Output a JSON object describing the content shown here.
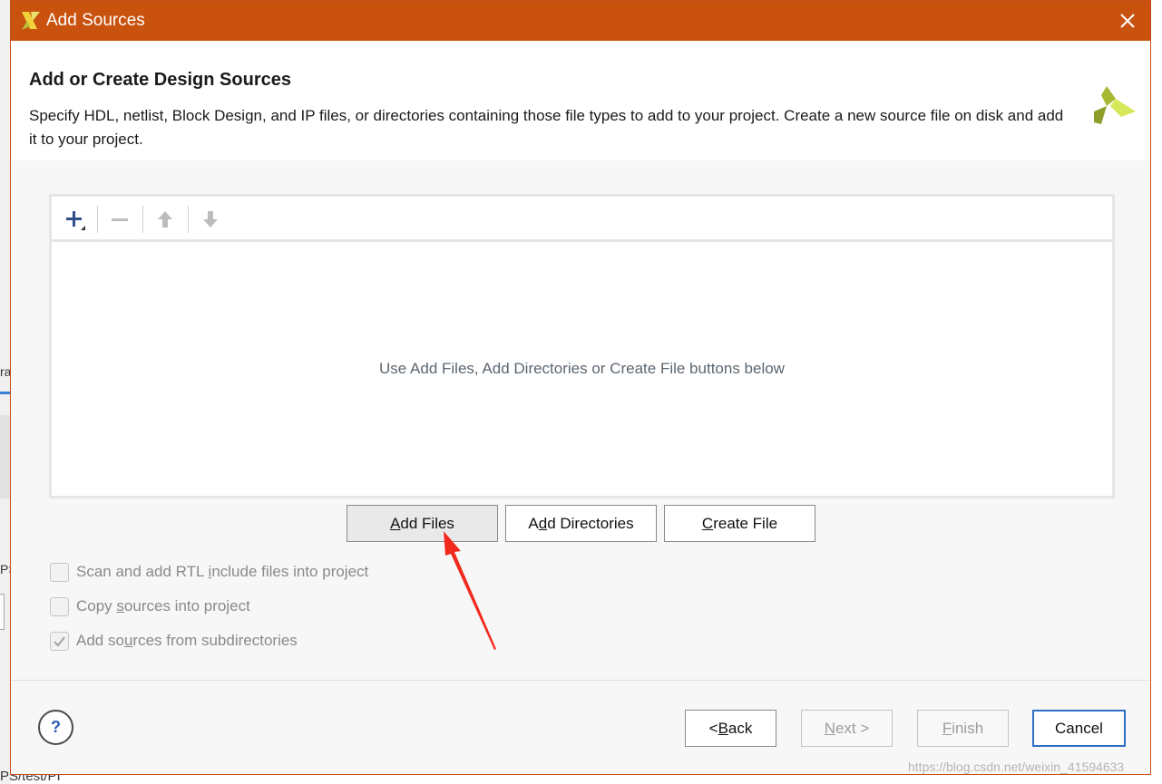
{
  "background": {
    "fragments": [
      "ra",
      "PS",
      "PS/test/PI"
    ]
  },
  "dialog": {
    "title": "Add Sources",
    "heading": "Add or Create Design Sources",
    "description": "Specify HDL, netlist, Block Design, and IP files, or directories containing those file types to add to your project. Create a new source file on disk and add it to your project.",
    "empty_message": "Use Add Files, Add Directories or Create File buttons below",
    "toolbar": {
      "add_icon": "plus-icon",
      "remove_icon": "minus-icon",
      "up_icon": "arrow-up-icon",
      "down_icon": "arrow-down-icon"
    },
    "buttons": {
      "add_files": {
        "mnemonic": "A",
        "rest": "dd Files"
      },
      "add_directories": {
        "pre": "A",
        "mnemonic": "d",
        "rest": "d Directories"
      },
      "create_file": {
        "mnemonic": "C",
        "rest": "reate File"
      }
    },
    "options": [
      {
        "pre": "Scan and add RTL ",
        "mnemonic": "i",
        "post": "nclude files into project",
        "checked": false
      },
      {
        "pre": "Copy ",
        "mnemonic": "s",
        "post": "ources into project",
        "checked": false
      },
      {
        "pre": "Add so",
        "mnemonic": "u",
        "post": "rces from subdirectories",
        "checked": true
      }
    ],
    "footer": {
      "help": "?",
      "back": {
        "pre": "< ",
        "mnemonic": "B",
        "rest": "ack"
      },
      "next": {
        "mnemonic": "N",
        "rest": "ext >"
      },
      "finish": {
        "mnemonic": "F",
        "rest": "inish"
      },
      "cancel": "Cancel"
    }
  },
  "watermark": "https://blog.csdn.net/weixin_41594633",
  "colors": {
    "titlebar": "#c9520f",
    "accent_blue": "#2e6fc6",
    "annotation_arrow": "#f22a1e",
    "logo_yellow": "#c5d93a",
    "logo_olive": "#8f9d2a"
  }
}
